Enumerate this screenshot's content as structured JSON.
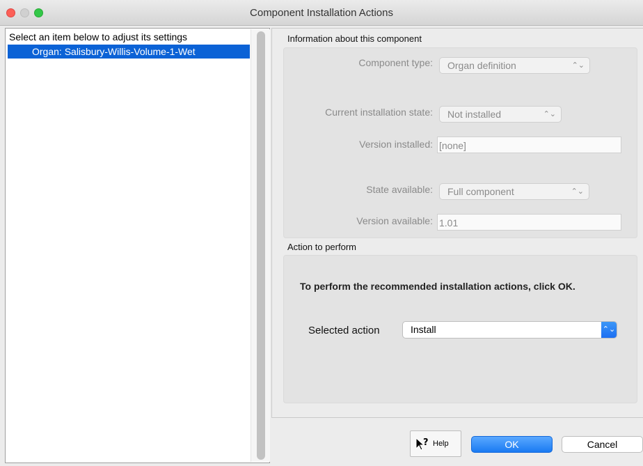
{
  "window": {
    "title": "Component Installation Actions"
  },
  "list": {
    "header": "Select an item below to adjust its settings",
    "items": [
      {
        "label": "Organ: Salisbury-Willis-Volume-1-Wet",
        "selected": true
      }
    ]
  },
  "info": {
    "section_title": "Information about this component",
    "component_type_label": "Component type:",
    "component_type_value": "Organ definition",
    "install_state_label": "Current installation state:",
    "install_state_value": "Not installed",
    "version_installed_label": "Version installed:",
    "version_installed_value": "[none]",
    "state_available_label": "State available:",
    "state_available_value": "Full component",
    "version_available_label": "Version available:",
    "version_available_value": "1.01"
  },
  "action": {
    "section_title": "Action to perform",
    "instruction": "To perform the recommended installation actions, click OK.",
    "selected_action_label": "Selected action",
    "selected_action_value": "Install"
  },
  "buttons": {
    "help_label": "Help",
    "ok_label": "OK",
    "cancel_label": "Cancel"
  },
  "icons": {
    "popup_chevron": "⌃⌄",
    "help_cursor": "help-cursor-icon"
  },
  "colors": {
    "selection": "#0b62d6",
    "accent": "#1a7bf2",
    "close": "#fc5f57",
    "zoom": "#33c748"
  }
}
